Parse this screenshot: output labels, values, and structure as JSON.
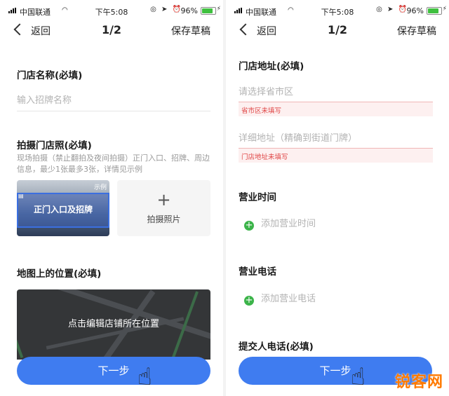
{
  "status_bar": {
    "carrier": "中国联通",
    "time": "下午5:08",
    "battery_pct": "96%",
    "battery_level": 0.96
  },
  "nav": {
    "back_label": "返回",
    "step": "1/2",
    "draft_label": "保存草稿"
  },
  "left": {
    "store_name": {
      "label": "门店名称(必填)",
      "placeholder": "输入招牌名称"
    },
    "photo": {
      "label": "拍摄门店照(必填)",
      "hint": "现场拍摄（禁止翻拍及夜间拍摄）正门入口、招牌、周边信息，最少1张最多3张，详情见示例",
      "sample_tag": "示例",
      "sample_caption": "正门入口及招牌",
      "add_label": "拍摄照片"
    },
    "map": {
      "label": "地图上的位置(必填)",
      "hint": "点击编辑店铺所在位置"
    },
    "next_button": "下一步"
  },
  "right": {
    "address": {
      "label": "门店地址(必填)",
      "province_placeholder": "请选择省市区",
      "province_error": "省市区未填写",
      "detail_placeholder": "详细地址（精确到街道门牌）",
      "detail_error": "门店地址未填写"
    },
    "hours": {
      "label": "营业时间",
      "add_label": "添加营业时间"
    },
    "phone": {
      "label": "营业电话",
      "add_label": "添加营业电话"
    },
    "submitter_phone": {
      "label": "提交人电话(必填)"
    },
    "next_button": "下一步"
  },
  "watermark": {
    "text": "锐客网"
  },
  "colors": {
    "primary": "#3f7cf0",
    "error": "#e04545",
    "add": "#3cb44a"
  }
}
